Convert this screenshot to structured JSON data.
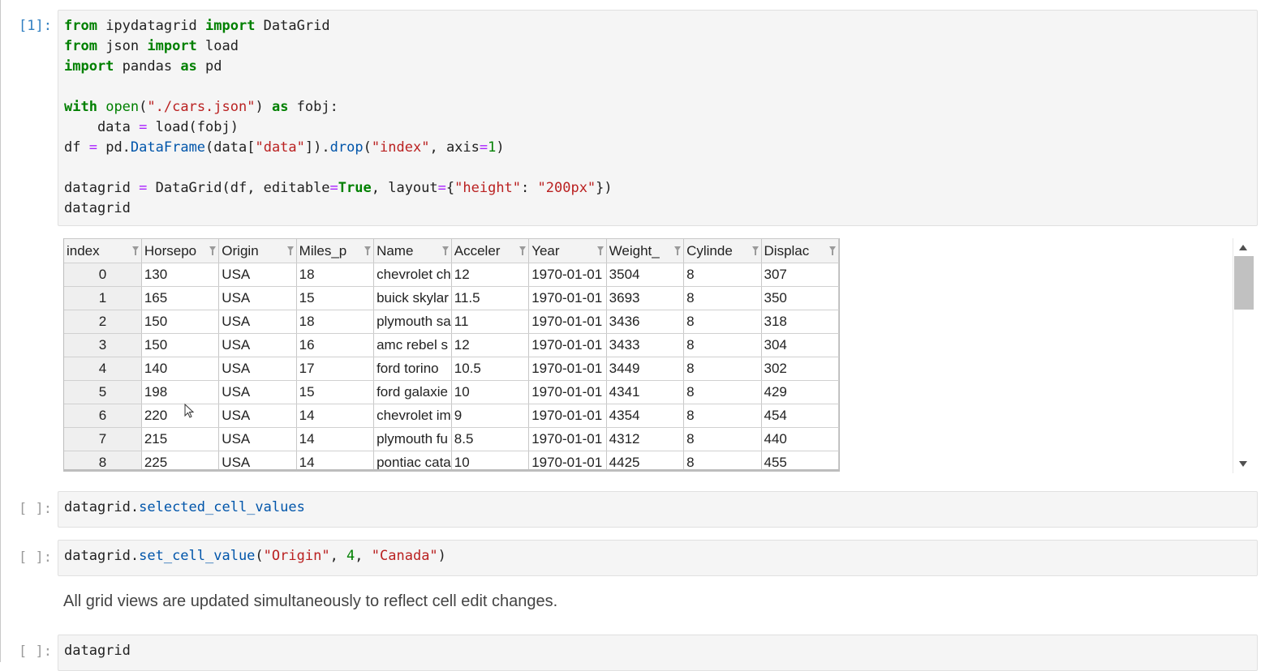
{
  "cells": {
    "cell1": {
      "prompt": "[1]:",
      "code_lines": [
        [
          {
            "t": "kw",
            "v": "from"
          },
          {
            "t": "tx",
            "v": " ipydatagrid "
          },
          {
            "t": "kw",
            "v": "import"
          },
          {
            "t": "tx",
            "v": " DataGrid"
          }
        ],
        [
          {
            "t": "kw",
            "v": "from"
          },
          {
            "t": "tx",
            "v": " json "
          },
          {
            "t": "kw",
            "v": "import"
          },
          {
            "t": "tx",
            "v": " load"
          }
        ],
        [
          {
            "t": "kw",
            "v": "import"
          },
          {
            "t": "tx",
            "v": " pandas "
          },
          {
            "t": "kw",
            "v": "as"
          },
          {
            "t": "tx",
            "v": " pd"
          }
        ],
        [],
        [
          {
            "t": "kw",
            "v": "with"
          },
          {
            "t": "tx",
            "v": " "
          },
          {
            "t": "bi",
            "v": "open"
          },
          {
            "t": "tx",
            "v": "("
          },
          {
            "t": "st",
            "v": "\"./cars.json\""
          },
          {
            "t": "tx",
            "v": ") "
          },
          {
            "t": "kw",
            "v": "as"
          },
          {
            "t": "tx",
            "v": " fobj:"
          }
        ],
        [
          {
            "t": "tx",
            "v": "    data "
          },
          {
            "t": "op",
            "v": "="
          },
          {
            "t": "tx",
            "v": " load(fobj)"
          }
        ],
        [
          {
            "t": "tx",
            "v": "df "
          },
          {
            "t": "op",
            "v": "="
          },
          {
            "t": "tx",
            "v": " pd."
          },
          {
            "t": "at",
            "v": "DataFrame"
          },
          {
            "t": "tx",
            "v": "(data["
          },
          {
            "t": "st",
            "v": "\"data\""
          },
          {
            "t": "tx",
            "v": "])."
          },
          {
            "t": "at",
            "v": "drop"
          },
          {
            "t": "tx",
            "v": "("
          },
          {
            "t": "st",
            "v": "\"index\""
          },
          {
            "t": "tx",
            "v": ", axis"
          },
          {
            "t": "op",
            "v": "="
          },
          {
            "t": "nu",
            "v": "1"
          },
          {
            "t": "tx",
            "v": ")"
          }
        ],
        [],
        [
          {
            "t": "tx",
            "v": "datagrid "
          },
          {
            "t": "op",
            "v": "="
          },
          {
            "t": "tx",
            "v": " DataGrid(df, editable"
          },
          {
            "t": "op",
            "v": "="
          },
          {
            "t": "kw",
            "v": "True"
          },
          {
            "t": "tx",
            "v": ", layout"
          },
          {
            "t": "op",
            "v": "="
          },
          {
            "t": "tx",
            "v": "{"
          },
          {
            "t": "st",
            "v": "\"height\""
          },
          {
            "t": "tx",
            "v": ": "
          },
          {
            "t": "st",
            "v": "\"200px\""
          },
          {
            "t": "tx",
            "v": "})"
          }
        ],
        [
          {
            "t": "tx",
            "v": "datagrid"
          }
        ]
      ]
    },
    "cell2": {
      "prompt": "[ ]:",
      "code_lines": [
        [
          {
            "t": "tx",
            "v": "datagrid."
          },
          {
            "t": "at",
            "v": "selected_cell_values"
          }
        ]
      ]
    },
    "cell3": {
      "prompt": "[ ]:",
      "code_lines": [
        [
          {
            "t": "tx",
            "v": "datagrid."
          },
          {
            "t": "at",
            "v": "set_cell_value"
          },
          {
            "t": "tx",
            "v": "("
          },
          {
            "t": "st",
            "v": "\"Origin\""
          },
          {
            "t": "tx",
            "v": ", "
          },
          {
            "t": "nu",
            "v": "4"
          },
          {
            "t": "tx",
            "v": ", "
          },
          {
            "t": "st",
            "v": "\"Canada\""
          },
          {
            "t": "tx",
            "v": ")"
          }
        ]
      ]
    },
    "markdown": {
      "text": "All grid views are updated simultaneously to reflect cell edit changes."
    },
    "cell4": {
      "prompt": "[ ]:",
      "code_lines": [
        [
          {
            "t": "tx",
            "v": "datagrid"
          }
        ]
      ]
    }
  },
  "datagrid": {
    "columns": [
      "index",
      "Horsepo",
      "Origin",
      "Miles_p",
      "Name",
      "Acceler",
      "Year",
      "Weight_",
      "Cylinde",
      "Displac"
    ],
    "rows": [
      [
        "0",
        "130",
        "USA",
        "18",
        "chevrolet ch",
        "12",
        "1970-01-01",
        "3504",
        "8",
        "307"
      ],
      [
        "1",
        "165",
        "USA",
        "15",
        "buick skylar",
        "11.5",
        "1970-01-01",
        "3693",
        "8",
        "350"
      ],
      [
        "2",
        "150",
        "USA",
        "18",
        "plymouth sa",
        "11",
        "1970-01-01",
        "3436",
        "8",
        "318"
      ],
      [
        "3",
        "150",
        "USA",
        "16",
        "amc rebel s",
        "12",
        "1970-01-01",
        "3433",
        "8",
        "304"
      ],
      [
        "4",
        "140",
        "USA",
        "17",
        "ford torino",
        "10.5",
        "1970-01-01",
        "3449",
        "8",
        "302"
      ],
      [
        "5",
        "198",
        "USA",
        "15",
        "ford galaxie",
        "10",
        "1970-01-01",
        "4341",
        "8",
        "429"
      ],
      [
        "6",
        "220",
        "USA",
        "14",
        "chevrolet im",
        "9",
        "1970-01-01",
        "4354",
        "8",
        "454"
      ],
      [
        "7",
        "215",
        "USA",
        "14",
        "plymouth fu",
        "8.5",
        "1970-01-01",
        "4312",
        "8",
        "440"
      ],
      [
        "8",
        "225",
        "USA",
        "14",
        "pontiac cata",
        "10",
        "1970-01-01",
        "4425",
        "8",
        "455"
      ]
    ],
    "filter_icon": "filter-funnel-icon"
  },
  "scrollbar": {
    "up_icon": "scroll-up-arrow-icon",
    "down_icon": "scroll-down-arrow-icon"
  },
  "colors": {
    "prompt_exec": "#307fc1",
    "keyword": "#008000",
    "string": "#ba2121",
    "operator": "#aa22ff",
    "attribute": "#0055aa"
  }
}
